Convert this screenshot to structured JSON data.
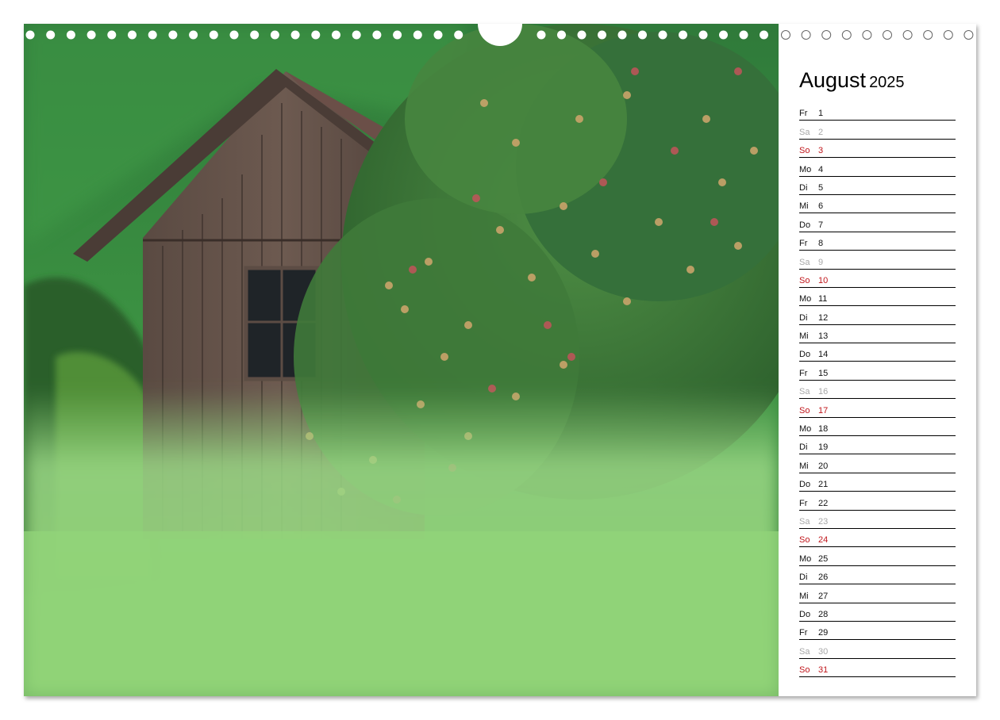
{
  "calendar": {
    "month": "August",
    "year": "2025",
    "days": [
      {
        "wd": "Fr",
        "d": "1",
        "type": "weekday"
      },
      {
        "wd": "Sa",
        "d": "2",
        "type": "sat"
      },
      {
        "wd": "So",
        "d": "3",
        "type": "sun"
      },
      {
        "wd": "Mo",
        "d": "4",
        "type": "weekday"
      },
      {
        "wd": "Di",
        "d": "5",
        "type": "weekday"
      },
      {
        "wd": "Mi",
        "d": "6",
        "type": "weekday"
      },
      {
        "wd": "Do",
        "d": "7",
        "type": "weekday"
      },
      {
        "wd": "Fr",
        "d": "8",
        "type": "weekday"
      },
      {
        "wd": "Sa",
        "d": "9",
        "type": "sat"
      },
      {
        "wd": "So",
        "d": "10",
        "type": "sun"
      },
      {
        "wd": "Mo",
        "d": "11",
        "type": "weekday"
      },
      {
        "wd": "Di",
        "d": "12",
        "type": "weekday"
      },
      {
        "wd": "Mi",
        "d": "13",
        "type": "weekday"
      },
      {
        "wd": "Do",
        "d": "14",
        "type": "weekday"
      },
      {
        "wd": "Fr",
        "d": "15",
        "type": "weekday"
      },
      {
        "wd": "Sa",
        "d": "16",
        "type": "sat"
      },
      {
        "wd": "So",
        "d": "17",
        "type": "sun"
      },
      {
        "wd": "Mo",
        "d": "18",
        "type": "weekday"
      },
      {
        "wd": "Di",
        "d": "19",
        "type": "weekday"
      },
      {
        "wd": "Mi",
        "d": "20",
        "type": "weekday"
      },
      {
        "wd": "Do",
        "d": "21",
        "type": "weekday"
      },
      {
        "wd": "Fr",
        "d": "22",
        "type": "weekday"
      },
      {
        "wd": "Sa",
        "d": "23",
        "type": "sat"
      },
      {
        "wd": "So",
        "d": "24",
        "type": "sun"
      },
      {
        "wd": "Mo",
        "d": "25",
        "type": "weekday"
      },
      {
        "wd": "Di",
        "d": "26",
        "type": "weekday"
      },
      {
        "wd": "Mi",
        "d": "27",
        "type": "weekday"
      },
      {
        "wd": "Do",
        "d": "28",
        "type": "weekday"
      },
      {
        "wd": "Fr",
        "d": "29",
        "type": "weekday"
      },
      {
        "wd": "Sa",
        "d": "30",
        "type": "sat"
      },
      {
        "wd": "So",
        "d": "31",
        "type": "sun"
      }
    ]
  },
  "photo": {
    "subject": "wooden-shed-and-apple-tree-photo"
  },
  "colors": {
    "sunday": "#c0161b",
    "saturday": "#a8a8a8",
    "weekday": "#111111"
  }
}
